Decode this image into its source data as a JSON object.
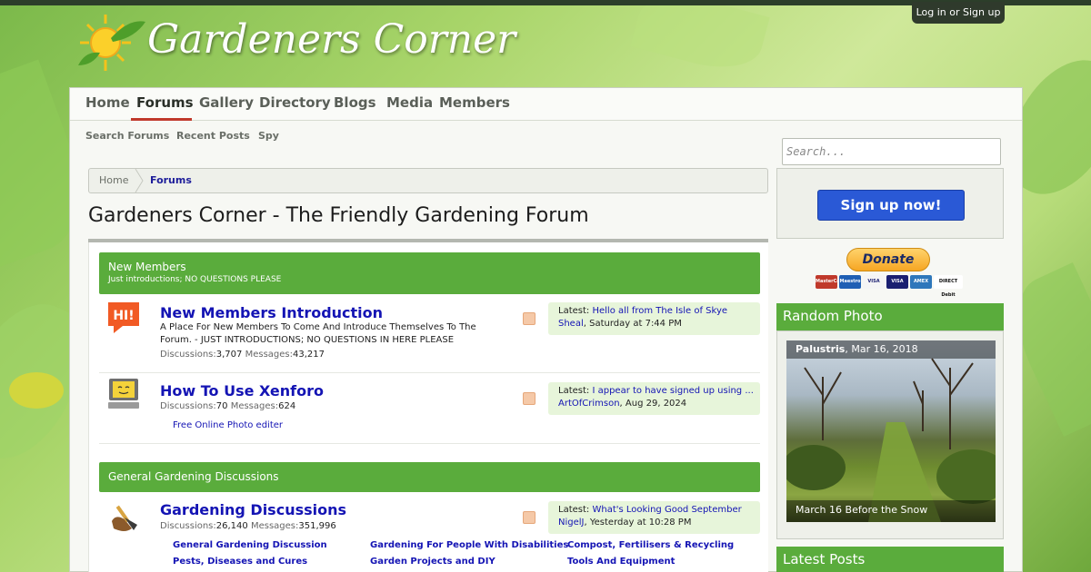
{
  "site": {
    "logo_text": "Gardeners Corner",
    "login_label": "Log in or Sign up"
  },
  "nav": {
    "items": [
      "Home",
      "Forums",
      "Gallery",
      "Directory",
      "Blogs",
      "Media",
      "Members"
    ],
    "active": "Forums",
    "subnav": [
      "Search Forums",
      "Recent Posts",
      "Spy"
    ]
  },
  "search": {
    "placeholder": "Search..."
  },
  "breadcrumb": [
    "Home",
    "Forums"
  ],
  "page_title": "Gardeners Corner - The Friendly Gardening Forum",
  "categories": [
    {
      "title": "New Members",
      "description": "Just introductions; NO QUESTIONS PLEASE",
      "nodes": [
        {
          "icon": "hi-speech-icon",
          "title": "New Members Introduction",
          "description": "A Place For New Members To Come And Introduce Themselves To The Forum. - JUST INTRODUCTIONS; NO QUESTIONS IN HERE PLEASE",
          "discussions_label": "Discussions:",
          "discussions": "3,707",
          "messages_label": "Messages:",
          "messages": "43,217",
          "latest_label": "Latest:",
          "latest_title": "Hello all from The Isle of Skye",
          "latest_user": "Sheal",
          "latest_time": ", Saturday at 7:44 PM"
        },
        {
          "icon": "computer-icon",
          "title": "How To Use Xenforo",
          "description": "",
          "discussions_label": "Discussions:",
          "discussions": "70",
          "messages_label": "Messages:",
          "messages": "624",
          "latest_label": "Latest:",
          "latest_title": "I appear to have signed up using ...",
          "latest_user": "ArtOfCrimson",
          "latest_time": ", Aug 29, 2024",
          "subforums": [
            "Free Online Photo editer"
          ]
        }
      ]
    },
    {
      "title": "General Gardening Discussions",
      "description": "",
      "nodes": [
        {
          "icon": "garden-tools-icon",
          "title": "Gardening Discussions",
          "description": "",
          "discussions_label": "Discussions:",
          "discussions": "26,140",
          "messages_label": "Messages:",
          "messages": "351,996",
          "latest_label": "Latest:",
          "latest_title": "What's Looking Good September",
          "latest_user": "NigelJ",
          "latest_time": ", Yesterday at 10:28 PM",
          "subforums": [
            "General Gardening Discussion",
            "Gardening For People With Disabilities",
            "Compost, Fertilisers & Recycling",
            "Pests, Diseases and Cures",
            "Garden Projects and DIY",
            "Tools And Equipment"
          ]
        }
      ]
    }
  ],
  "sidebar": {
    "signup_label": "Sign up now!",
    "donate_label": "Donate",
    "cards": [
      "MasterCard",
      "Maestro",
      "VISA",
      "VISA",
      "AMEX",
      "DIRECT Debit"
    ],
    "random_photo_title": "Random Photo",
    "photo_user": "Palustris",
    "photo_date": ", Mar 16, 2018",
    "photo_caption": "March 16 Before the Snow",
    "latest_posts_title": "Latest Posts"
  },
  "colors": {
    "accent_green": "#5aac3c",
    "link_blue": "#1414b4",
    "signup_blue": "#2a59d6",
    "nav_active_underline": "#c0392b"
  }
}
